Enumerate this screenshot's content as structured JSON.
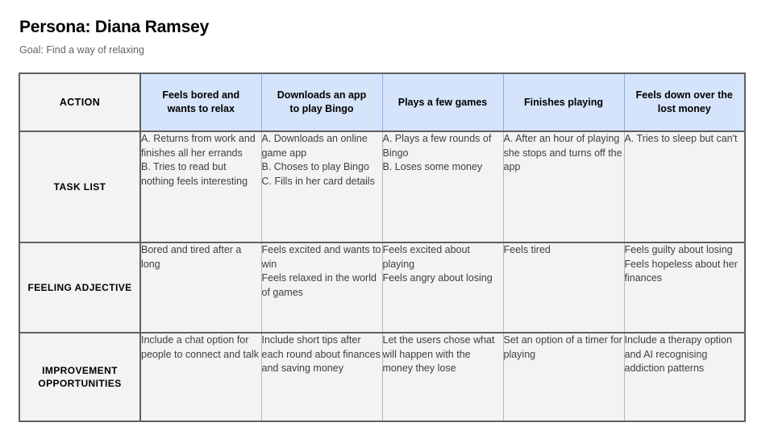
{
  "header": {
    "title": "Persona: Diana Ramsey",
    "subtitle": "Goal: Find a way of relaxing"
  },
  "colors": {
    "stage_header_fill": "#d5e4fa",
    "cell_fill": "#f3f3f3",
    "border": "#5f6063",
    "title_text": "#000000",
    "subtitle_text": "#5f6368",
    "body_text": "#3c4043"
  },
  "table": {
    "corner_label": "ACTION",
    "stages": [
      "Feels bored and wants to relax",
      "Downloads an app to play Bingo",
      "Plays a few games",
      "Finishes playing",
      "Feels down over the lost money"
    ],
    "rows": [
      {
        "label": "TASK LIST",
        "cells": [
          "A. Returns from work and finishes all her errands\nB. Tries to read but nothing feels interesting",
          "A. Downloads an online game app\nB. Choses to play Bingo\nC. Fills in her card details",
          "A. Plays a few rounds of Bingo\nB. Loses some money",
          "A. After an hour of playing she stops and turns off the app",
          "A. Tries to sleep but can't"
        ]
      },
      {
        "label": "FEELING ADJECTIVE",
        "cells": [
          "Bored and tired after a long",
          "Feels excited and wants to win\nFeels relaxed in the world of games",
          "Feels excited about playing\nFeels angry about losing",
          "Feels tired",
          "Feels guilty about losing\nFeels hopeless about her finances"
        ]
      },
      {
        "label": "IMPROVEMENT OPPORTUNITIES",
        "cells": [
          "Include a chat option for people to connect and talk",
          "Include short tips after each round about finances and saving money",
          "Let the users chose what will happen with the money they lose",
          "Set an option of a timer for playing",
          "Include a therapy option and AI recognising addiction patterns"
        ]
      }
    ]
  }
}
